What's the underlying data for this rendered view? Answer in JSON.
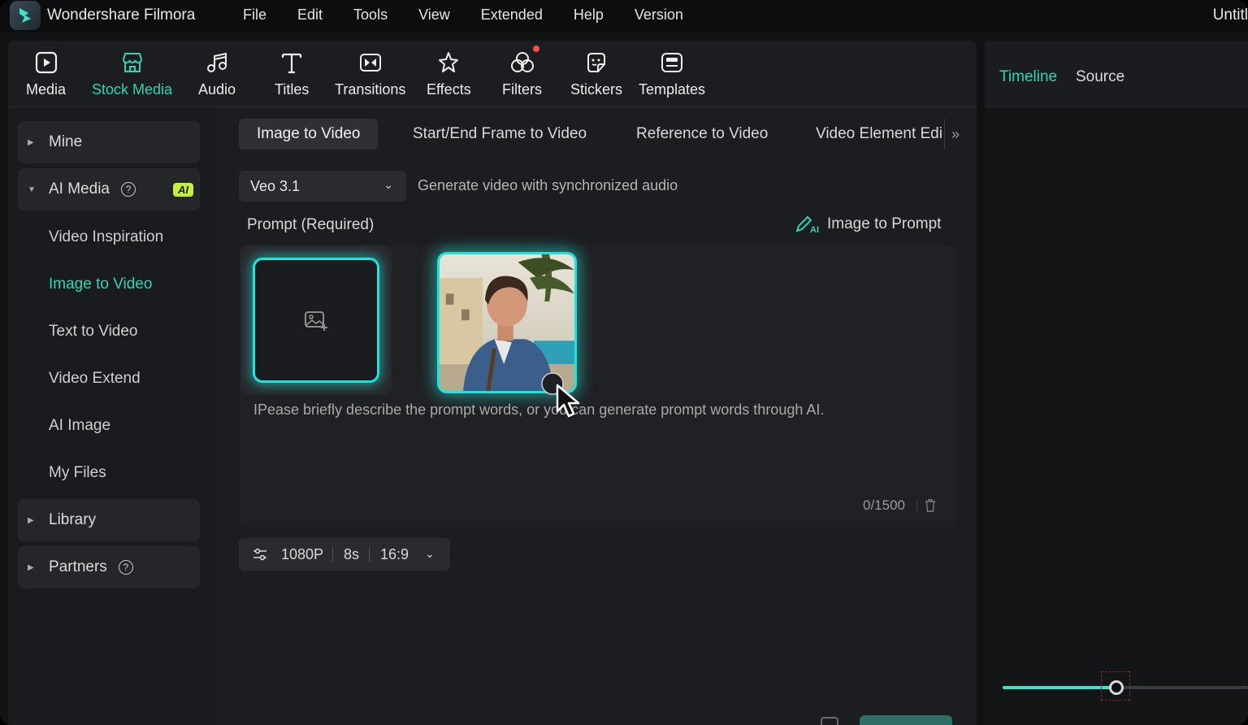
{
  "app": {
    "name": "Wondershare Filmora",
    "doc_title": "Untitl"
  },
  "menu": [
    "File",
    "Edit",
    "Tools",
    "View",
    "Extended",
    "Help",
    "Version"
  ],
  "toolbar": [
    {
      "label": "Media",
      "icon": "media-icon"
    },
    {
      "label": "Stock Media",
      "icon": "store-icon",
      "active": true
    },
    {
      "label": "Audio",
      "icon": "music-note-icon"
    },
    {
      "label": "Titles",
      "icon": "text-t-icon"
    },
    {
      "label": "Transitions",
      "icon": "transition-icon"
    },
    {
      "label": "Effects",
      "icon": "sparkle-star-icon"
    },
    {
      "label": "Filters",
      "icon": "filters-icon",
      "notification": true
    },
    {
      "label": "Stickers",
      "icon": "sticker-icon"
    },
    {
      "label": "Templates",
      "icon": "template-icon"
    }
  ],
  "sidebar": {
    "groups": [
      {
        "label": "Mine"
      },
      {
        "label": "AI Media",
        "badge": "AI"
      },
      {
        "label": "Library"
      },
      {
        "label": "Partners"
      }
    ],
    "items": [
      "Video Inspiration",
      "Image to Video",
      "Text to Video",
      "Video Extend",
      "AI Image",
      "My Files"
    ],
    "active_item": "Image to Video"
  },
  "tabs": [
    "Image to Video",
    "Start/End Frame to Video",
    "Reference to Video",
    "Video Element Edi"
  ],
  "model": {
    "selected": "Veo 3.1",
    "description": "Generate video with synchronized audio"
  },
  "prompt": {
    "label": "Prompt (Required)",
    "image_to_prompt": "Image to Prompt",
    "placeholder": "IPease briefly describe the prompt words, or you can generate prompt words through AI.",
    "count": "0/1500"
  },
  "settings": {
    "resolution": "1080P",
    "duration": "8s",
    "aspect": "16:9"
  },
  "right_panel": {
    "tabs": [
      "Timeline",
      "Source"
    ],
    "zoom_slider_fraction": 0.46
  },
  "colors": {
    "accent": "#2fd4b4",
    "glow": "#22e3da",
    "ai_badge": "#c6f03b"
  }
}
